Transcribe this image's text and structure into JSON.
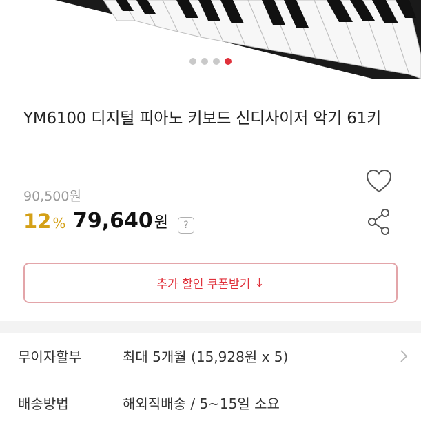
{
  "product": {
    "title": "YM6100 디지털 피아노 키보드 신디사이저 악기 61키",
    "original_price": "90,500원",
    "discount_percent": "12",
    "discount_symbol": "%",
    "sale_price": "79,640",
    "sale_price_unit": "원",
    "help_mark": "?"
  },
  "gallery": {
    "current_slide": 4,
    "slide_count": 4
  },
  "coupon": {
    "label": "추가 할인 쿠폰받기",
    "download_glyph": "↓"
  },
  "info_rows": [
    {
      "label": "무이자할부",
      "value": "최대 5개월 (15,928원 x 5)"
    },
    {
      "label": "배송방법",
      "value": "해외직배송 / 5~15일 소요"
    }
  ],
  "colors": {
    "accent_red": "#e0313b",
    "discount_gold": "#d4a017",
    "strike_gray": "#9a9a9a"
  },
  "icons": [
    "heart-icon",
    "share-icon",
    "help-icon",
    "chevron-right-icon",
    "download-icon"
  ]
}
